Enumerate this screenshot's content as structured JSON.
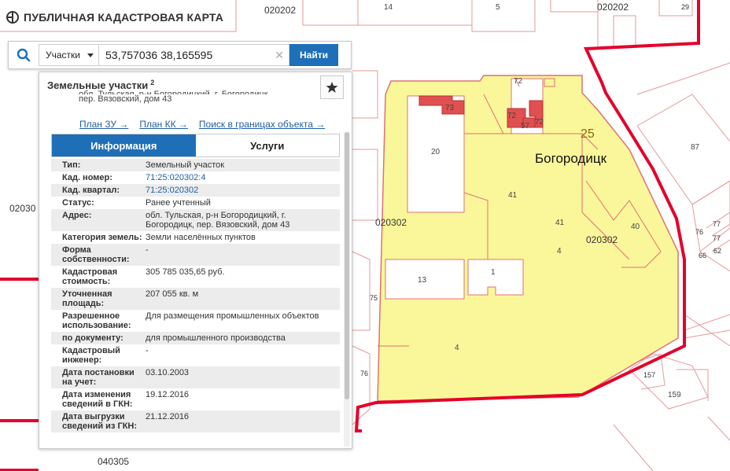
{
  "app": {
    "title": "ПУБЛИЧНАЯ КАДАСТРОВАЯ КАРТА"
  },
  "search": {
    "type_label": "Участки",
    "query": "53,757036 38,165595",
    "find_label": "Найти"
  },
  "panel": {
    "title": "Земельные участки",
    "count": "2",
    "address_cut_line1": "обл. Тульская, р-н Богородицкий, г. Богородицк,",
    "address_cut_line2": "пер. Вязовский, дом 43",
    "links": {
      "plan_zu": "План ЗУ →",
      "plan_kk": "План КК →",
      "search_bounds": "Поиск в границах объекта →"
    },
    "tabs": {
      "info": "Информация",
      "services": "Услуги"
    },
    "rows": [
      {
        "k": "Тип:",
        "v": "Земельный участок"
      },
      {
        "k": "Кад. номер:",
        "v": "71:25:020302:4"
      },
      {
        "k": "Кад. квартал:",
        "v": "71:25:020302"
      },
      {
        "k": "Статус:",
        "v": "Ранее учтенный"
      },
      {
        "k": "Адрес:",
        "v": "обл. Тульская, р-н Богородицкий, г. Богородицк, пер. Вязовский, дом 43"
      },
      {
        "k": "Категория земель:",
        "v": "Земли населённых пунктов"
      },
      {
        "k": "Форма собственности:",
        "v": "-"
      },
      {
        "k": "Кадастровая стоимость:",
        "v": "305 785 035,65 руб."
      },
      {
        "k": "Уточненная площадь:",
        "v": "207 055 кв. м"
      },
      {
        "k": "Разрешенное использование:",
        "v": "Для размещения промышленных объектов"
      },
      {
        "k": "по документу:",
        "v": "для промышленного производства"
      },
      {
        "k": "Кадастровый инженер:",
        "v": "-"
      },
      {
        "k": "Дата постановки на учет:",
        "v": "03.10.2003"
      },
      {
        "k": "Дата изменения сведений в ГКН:",
        "v": "19.12.2016"
      },
      {
        "k": "Дата выгрузки сведений из ГКН:",
        "v": "21.12.2016"
      }
    ]
  },
  "map": {
    "city": "Богородицк",
    "quarters": [
      "020202",
      "020202",
      "02030",
      "020302",
      "020302",
      "040305"
    ],
    "parcels": [
      "14",
      "5",
      "73",
      "72",
      "72",
      "57",
      "72",
      "20",
      "25",
      "87",
      "41",
      "41",
      "40",
      "4",
      "13",
      "1",
      "75",
      "4",
      "76",
      "157",
      "159",
      "77",
      "77",
      "76",
      "66",
      "62",
      "29"
    ]
  },
  "colors": {
    "accent": "#1e6fb8",
    "boundary": "#e4002b",
    "parcel_fill": "#faf79a",
    "link": "#1f5fa3"
  }
}
